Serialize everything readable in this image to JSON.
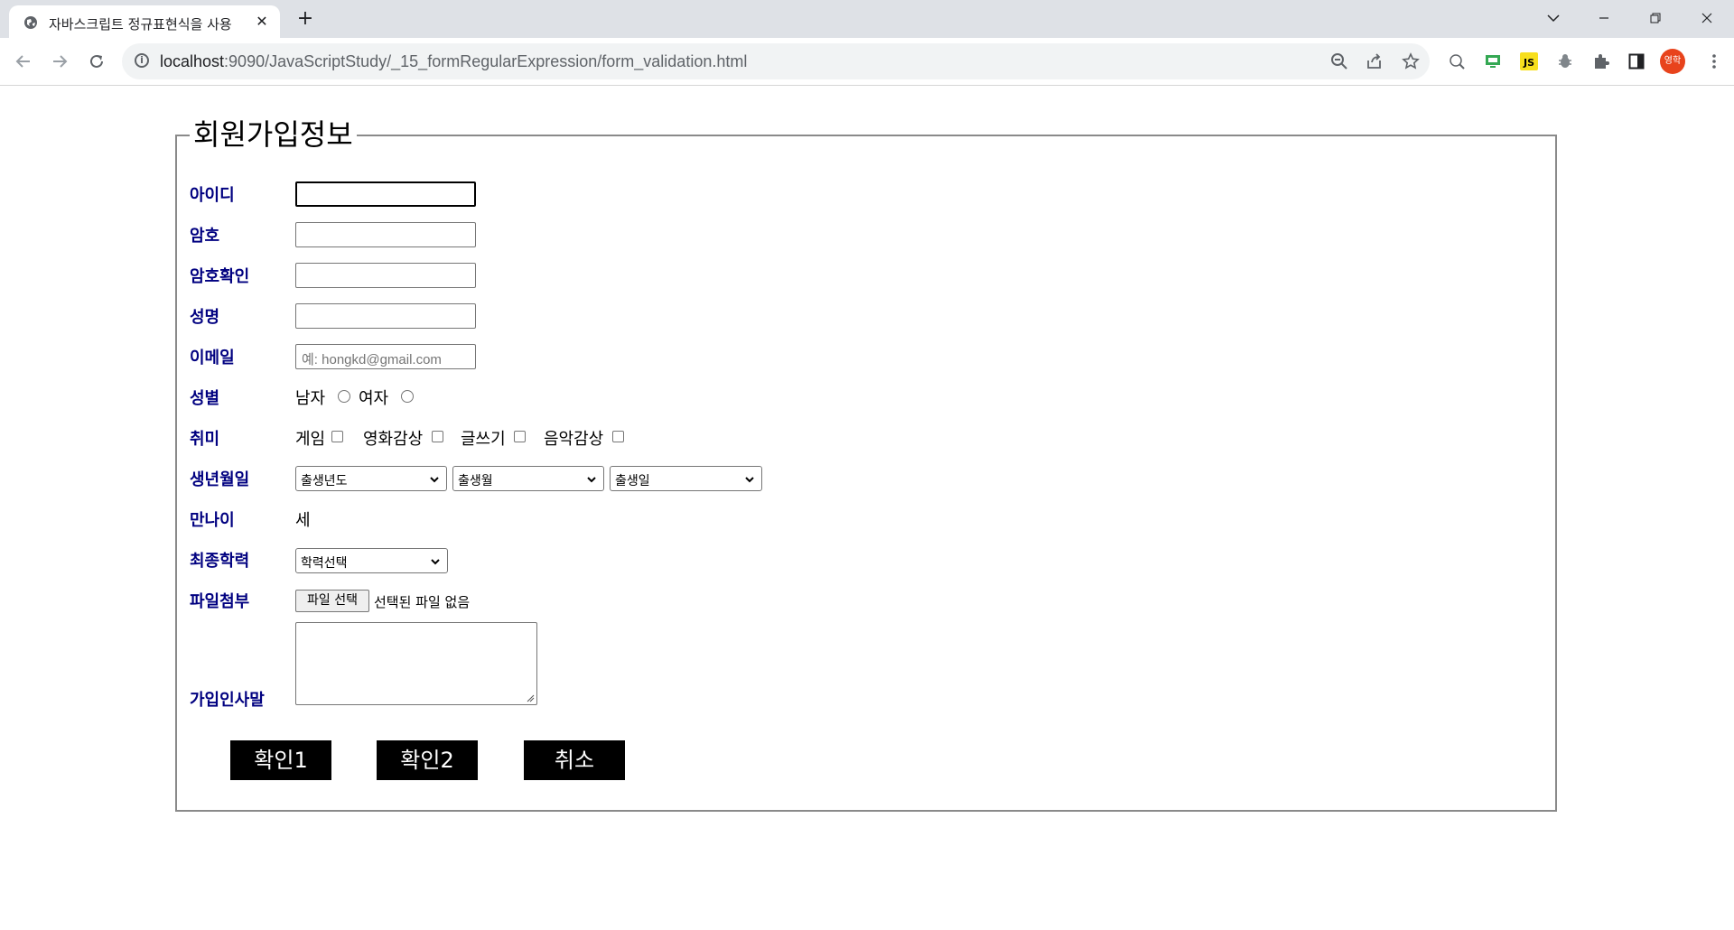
{
  "browser": {
    "tab_title": "자바스크립트 정규표현식을 사용",
    "url_host": "localhost",
    "url_rest": ":9090/JavaScriptStudy/_15_formRegularExpression/form_validation.html",
    "profile_label": "영학",
    "extension_js_label": "JS"
  },
  "form": {
    "legend": "회원가입정보",
    "labels": {
      "id": "아이디",
      "password": "암호",
      "password_confirm": "암호확인",
      "name": "성명",
      "email": "이메일",
      "gender": "성별",
      "hobby": "취미",
      "birth": "생년월일",
      "age": "만나이",
      "education": "최종학력",
      "file": "파일첨부",
      "greeting": "가입인사말"
    },
    "email_placeholder": "예: hongkd@gmail.com",
    "gender_options": [
      "남자",
      "여자"
    ],
    "hobby_options": [
      "게임",
      "영화감상",
      "글쓰기",
      "음악감상"
    ],
    "birth_selects": [
      "출생년도",
      "출생월",
      "출생일"
    ],
    "age_unit": "세",
    "education_select": "학력선택",
    "file_button": "파일 선택",
    "file_status": "선택된 파일 없음",
    "buttons": [
      "확인1",
      "확인2",
      "취소"
    ]
  }
}
